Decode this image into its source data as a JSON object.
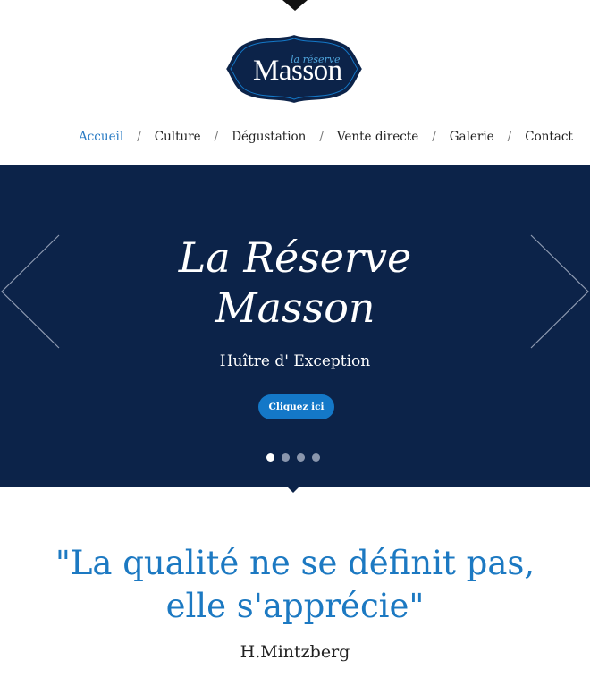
{
  "colors": {
    "navy": "#0c2349",
    "accent_blue": "#1c79c2",
    "button_blue": "#1478c8",
    "nav_active": "#2b7cc4"
  },
  "logo": {
    "small_text": "la réserve",
    "big_text": "Masson"
  },
  "nav": {
    "items": [
      {
        "label": "Accueil",
        "active": true
      },
      {
        "label": "Culture"
      },
      {
        "label": "Dégustation"
      },
      {
        "label": "Vente directe"
      },
      {
        "label": "Galerie"
      },
      {
        "label": "Contact"
      }
    ],
    "separator": "/"
  },
  "hero": {
    "title_line1": "La Réserve",
    "title_line2": "Masson",
    "subtitle": "Huître d' Exception",
    "button_label": "Cliquez ici",
    "prev_icon": "chevron-left-icon",
    "next_icon": "chevron-right-icon",
    "slide_count": 4,
    "active_slide": 1
  },
  "quote": {
    "line1": "\"La qualité ne se définit pas,",
    "line2": "elle s'apprécie\"",
    "author": "H.Mintzberg"
  }
}
